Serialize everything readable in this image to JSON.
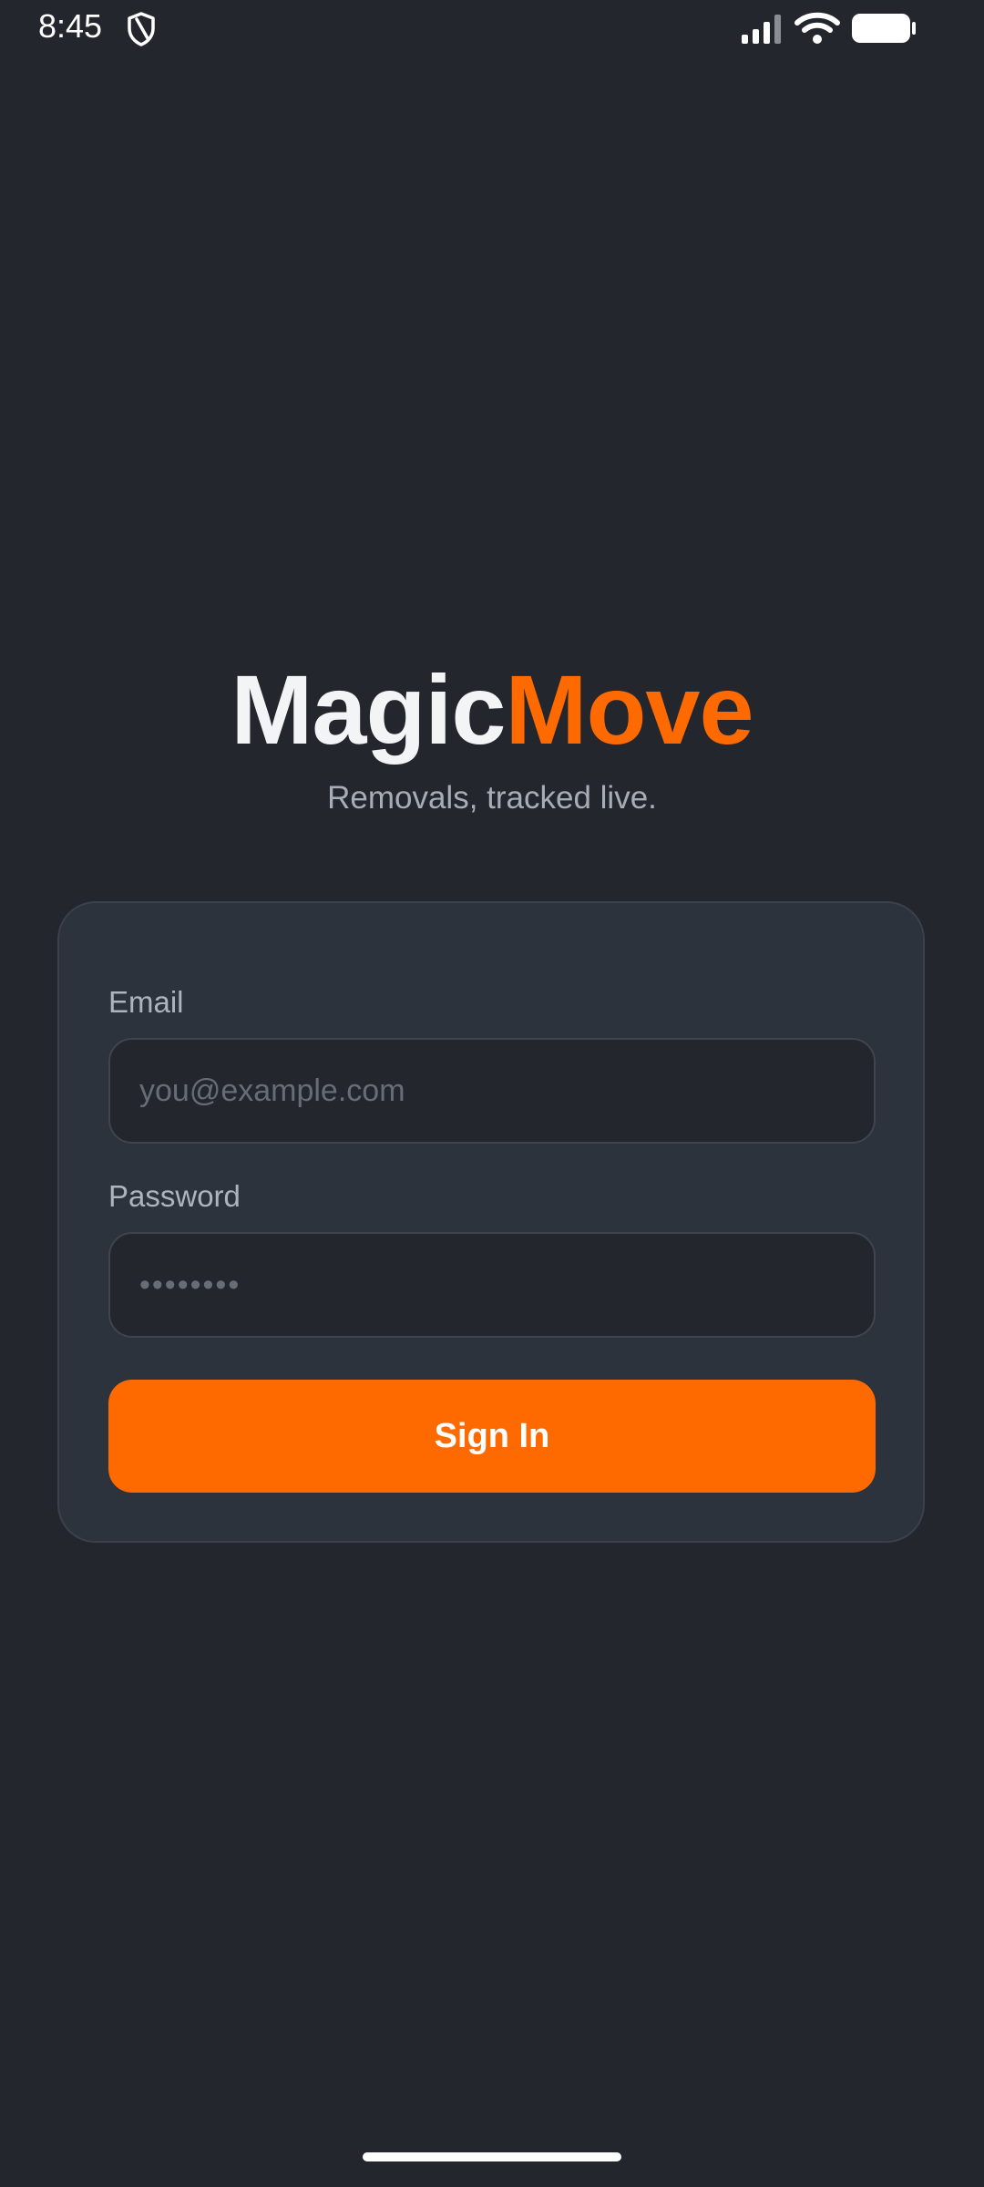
{
  "status_bar": {
    "time": "8:45",
    "icons": [
      "shield-icon",
      "signal-icon",
      "wifi-icon",
      "battery-icon"
    ]
  },
  "brand": {
    "name_primary": "Magic",
    "name_accent": "Move",
    "tagline": "Removals, tracked live."
  },
  "login_form": {
    "email_label": "Email",
    "email_placeholder": "you@example.com",
    "email_value": "",
    "password_label": "Password",
    "password_placeholder": "••••••••",
    "password_value": "",
    "submit_label": "Sign In"
  },
  "colors": {
    "background": "#23262c",
    "card": "#2d333d",
    "accent": "#ff6a00",
    "brand_text": "#f3f4f6",
    "muted_text": "#a7adb7"
  }
}
